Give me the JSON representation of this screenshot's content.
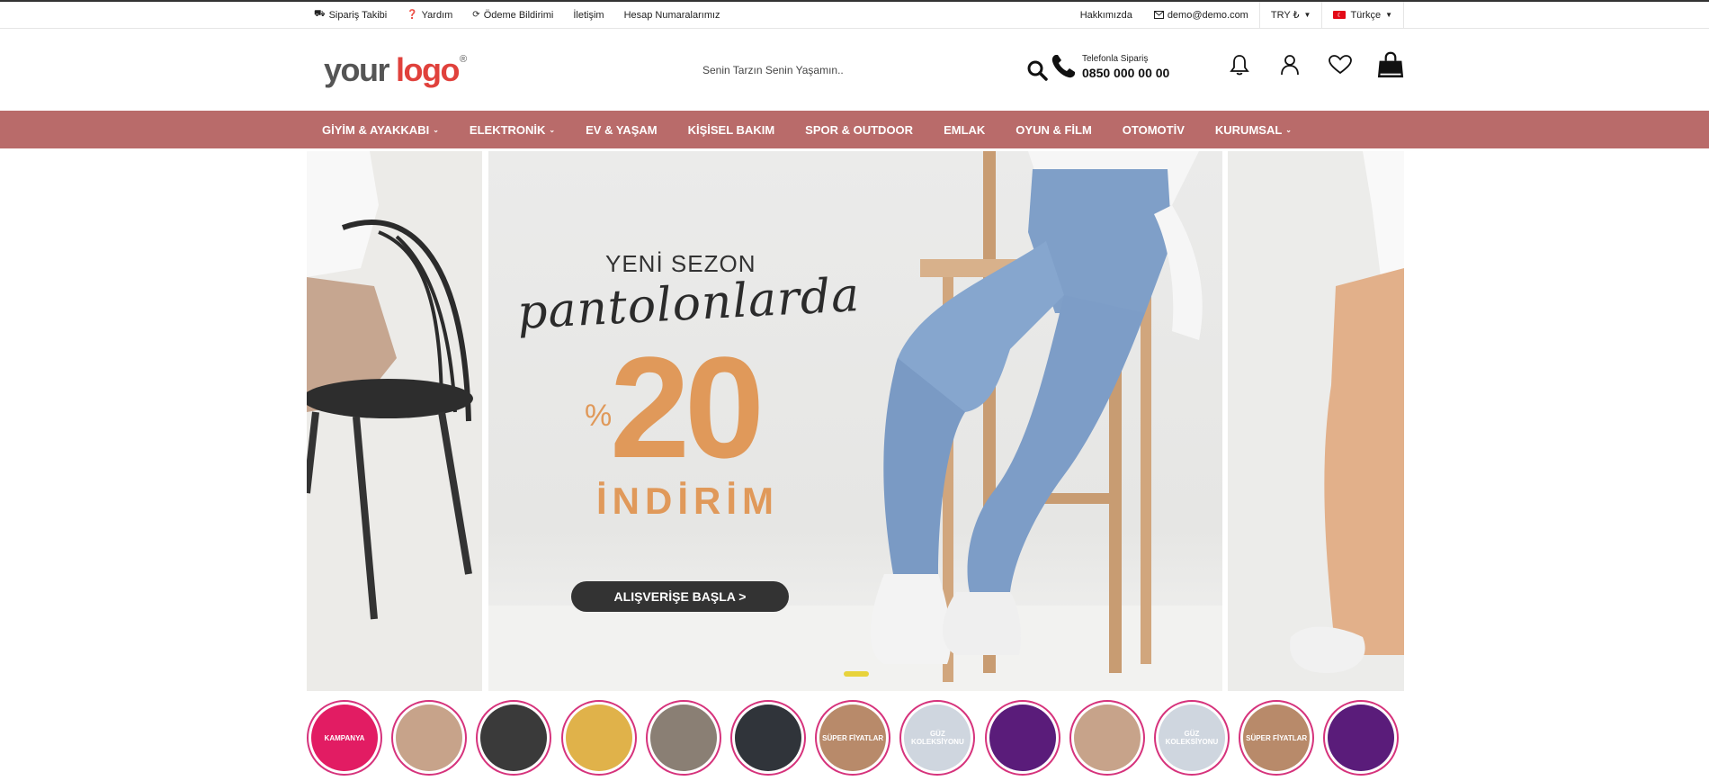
{
  "topbar": {
    "left_links": [
      {
        "label": "Sipariş Takibi",
        "icon": "truck-icon",
        "glyph": "⛟"
      },
      {
        "label": "Yardım",
        "icon": "question-icon",
        "glyph": "❓"
      },
      {
        "label": "Ödeme Bildirimi",
        "icon": "refresh-icon",
        "glyph": "⟳"
      },
      {
        "label": "İletişim",
        "icon": "",
        "glyph": ""
      },
      {
        "label": "Hesap Numaralarımız",
        "icon": "",
        "glyph": ""
      }
    ],
    "about": "Hakkımızda",
    "email": "demo@demo.com",
    "currency": "TRY ₺",
    "language": "Türkçe"
  },
  "header": {
    "logo": {
      "your": "your",
      "logo": "logo",
      "reg": "®"
    },
    "search": {
      "placeholder": "Senin Tarzın Senin Yaşamın.."
    },
    "phone": {
      "label": "Telefonla Sipariş",
      "number": "0850 000 00 00"
    },
    "icons": [
      "bell-icon",
      "user-icon",
      "heart-icon",
      "shopping-bag-icon"
    ]
  },
  "nav": {
    "items": [
      {
        "label": "GİYİM & AYAKKABI",
        "has_dropdown": true
      },
      {
        "label": "ELEKTRONİK",
        "has_dropdown": true
      },
      {
        "label": "EV & YAŞAM",
        "has_dropdown": false
      },
      {
        "label": "KİŞİSEL BAKIM",
        "has_dropdown": false
      },
      {
        "label": "SPOR & OUTDOOR",
        "has_dropdown": false
      },
      {
        "label": "EMLAK",
        "has_dropdown": false
      },
      {
        "label": "OYUN & FİLM",
        "has_dropdown": false
      },
      {
        "label": "OTOMOTİV",
        "has_dropdown": false
      },
      {
        "label": "KURUMSAL",
        "has_dropdown": true
      }
    ]
  },
  "slider": {
    "line1": "YENİ SEZON",
    "line2": "pantolonlarda",
    "pct": "%",
    "value": "20",
    "line3": "İNDİRİM",
    "cta": "ALIŞVERİŞE BAŞLA   >"
  },
  "stories": [
    {
      "label": "KAMPANYA",
      "bg": "#e21c63"
    },
    {
      "label": "",
      "bg": "#c7a38a"
    },
    {
      "label": "",
      "bg": "#3a3a3a"
    },
    {
      "label": "",
      "bg": "#e0b24a"
    },
    {
      "label": "",
      "bg": "#8a7f74"
    },
    {
      "label": "",
      "bg": "#30343a"
    },
    {
      "label": "SÜPER FİYATLAR",
      "bg": "#b88a6a"
    },
    {
      "label": "GÜZ KOLEKSİYONU",
      "bg": "#cfd6df"
    },
    {
      "label": "",
      "bg": "#5a1c7a"
    },
    {
      "label": "",
      "bg": "#c7a38a"
    },
    {
      "label": "GÜZ KOLEKSİYONU",
      "bg": "#cfd6df"
    },
    {
      "label": "SÜPER FİYATLAR",
      "bg": "#b88a6a"
    },
    {
      "label": "",
      "bg": "#5a1c7a"
    }
  ],
  "colors": {
    "nav_bg": "#b96b6a",
    "accent": "#e0413c",
    "promo": "#e0995a",
    "story_ring": "#d6337c"
  }
}
